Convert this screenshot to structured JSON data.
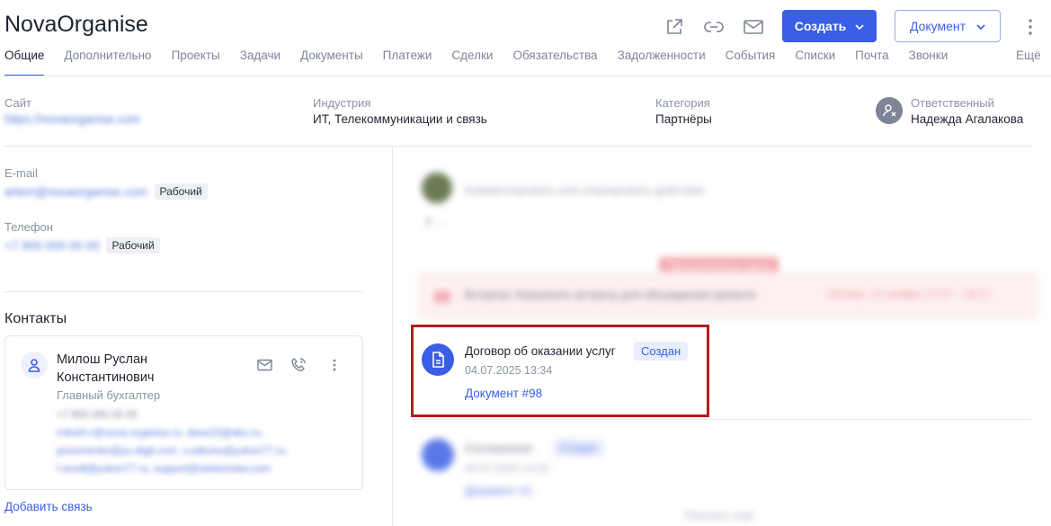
{
  "app": {
    "title": "NovaOrganise"
  },
  "header": {
    "create_label": "Создать",
    "document_label": "Документ",
    "icons": [
      "external-link-icon",
      "link-icon",
      "mail-icon",
      "chevron-down-icon",
      "kebab-icon"
    ]
  },
  "tabs": {
    "items": [
      {
        "label": "Общие",
        "active": true
      },
      {
        "label": "Дополнительно"
      },
      {
        "label": "Проекты"
      },
      {
        "label": "Задачи"
      },
      {
        "label": "Документы"
      },
      {
        "label": "Платежи"
      },
      {
        "label": "Сделки"
      },
      {
        "label": "Обязательства"
      },
      {
        "label": "Задолженности"
      },
      {
        "label": "События"
      },
      {
        "label": "Списки"
      },
      {
        "label": "Почта"
      },
      {
        "label": "Звонки"
      }
    ],
    "more": "Ещё"
  },
  "info": {
    "site_label": "Сайт",
    "site_value": "https://novaorganise.com",
    "industry_label": "Индустрия",
    "industry_value": "ИТ, Телекоммуникации и связь",
    "category_label": "Категория",
    "category_value": "Партнёры",
    "responsible_label": "Ответственный",
    "responsible_value": "Надежда Агалакова"
  },
  "contact_info": {
    "email_label": "E-mail",
    "email_value": "artem@novaorganise.com",
    "email_badge": "Рабочий",
    "phone_label": "Телефон",
    "phone_value": "+7 900 000 00 00",
    "phone_badge": "Рабочий"
  },
  "contacts": {
    "title": "Контакты",
    "name_line1": "Милош Руслан",
    "name_line2": "Константинович",
    "role": "Главный бухгалтер",
    "blurred_lines": [
      "+7 900 000 00 00",
      "milosh-r@nova-organise.ru, dave23@abc.ru,",
      "ponomenko@yu-digit.com, v.sakuno@yukon77.ru,",
      "l.smolt@yukon77.ru, support@stelemotav.com"
    ],
    "add_link": "Добавить связь"
  },
  "timeline": {
    "comment_placeholder": "Комментировать или планировать действие",
    "overdue_badge": "Просроченные дела",
    "meeting_text": "Встреча: Назначить встречу для обсуждения проекта",
    "meeting_time": "Четверг, 14 ноября 17:17 – 18:17",
    "doc": {
      "title": "Договор об оказании услуг",
      "status": "Создан",
      "date": "04.07.2025 13:34",
      "link": "Документ #98"
    },
    "doc2": {
      "title": "Соглашение",
      "status": "Создан",
      "date": "04.07.2025 13:22",
      "link": "Документ #1"
    },
    "more_text": "Показать ещё"
  },
  "colors": {
    "accent": "#3a5fe6",
    "highlight": "#b71c1c"
  }
}
